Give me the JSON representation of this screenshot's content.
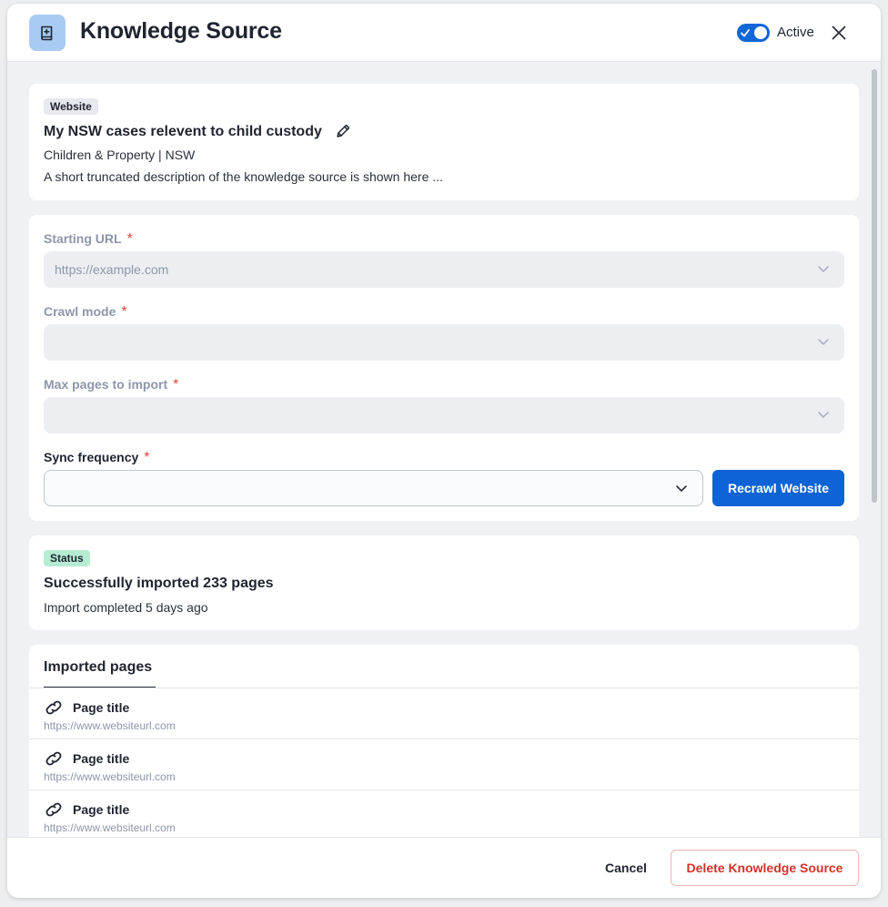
{
  "header": {
    "title": "Knowledge Source",
    "toggle_label": "Active",
    "toggle_on": true
  },
  "source_card": {
    "type_tag": "Website",
    "title": "My NSW cases relevent to child custody",
    "subtitle": "Children & Property | NSW",
    "description": "A short truncated description of the knowledge source is shown here ..."
  },
  "form": {
    "starting_url": {
      "label": "Starting URL",
      "required": "*",
      "placeholder": "https://example.com",
      "value": ""
    },
    "crawl_mode": {
      "label": "Crawl mode",
      "required": "*",
      "value": ""
    },
    "max_pages": {
      "label": "Max pages to import",
      "required": "*",
      "value": ""
    },
    "sync_frequency": {
      "label": "Sync frequency",
      "required": "*",
      "value": ""
    },
    "recrawl_label": "Recrawl Website"
  },
  "status": {
    "tag": "Status",
    "title": "Successfully imported 233 pages",
    "subtitle": "Import completed 5 days ago"
  },
  "imported_pages": {
    "tab_label": "Imported pages",
    "items": [
      {
        "title": "Page title",
        "url": "https://www.websiteurl.com"
      },
      {
        "title": "Page title",
        "url": "https://www.websiteurl.com"
      },
      {
        "title": "Page title",
        "url": "https://www.websiteurl.com"
      }
    ]
  },
  "footer": {
    "cancel_label": "Cancel",
    "delete_label": "Delete Knowledge Source"
  },
  "colors": {
    "accent": "#0e63d6",
    "danger": "#d6302a",
    "status_tag_bg": "#b6ecd2",
    "header_icon_bg": "#a9cbf3"
  },
  "icons": {
    "header": "book-plus-icon",
    "close": "close-icon",
    "edit": "pencil-icon",
    "dropdown": "chevron-down-icon",
    "link": "link-icon"
  }
}
